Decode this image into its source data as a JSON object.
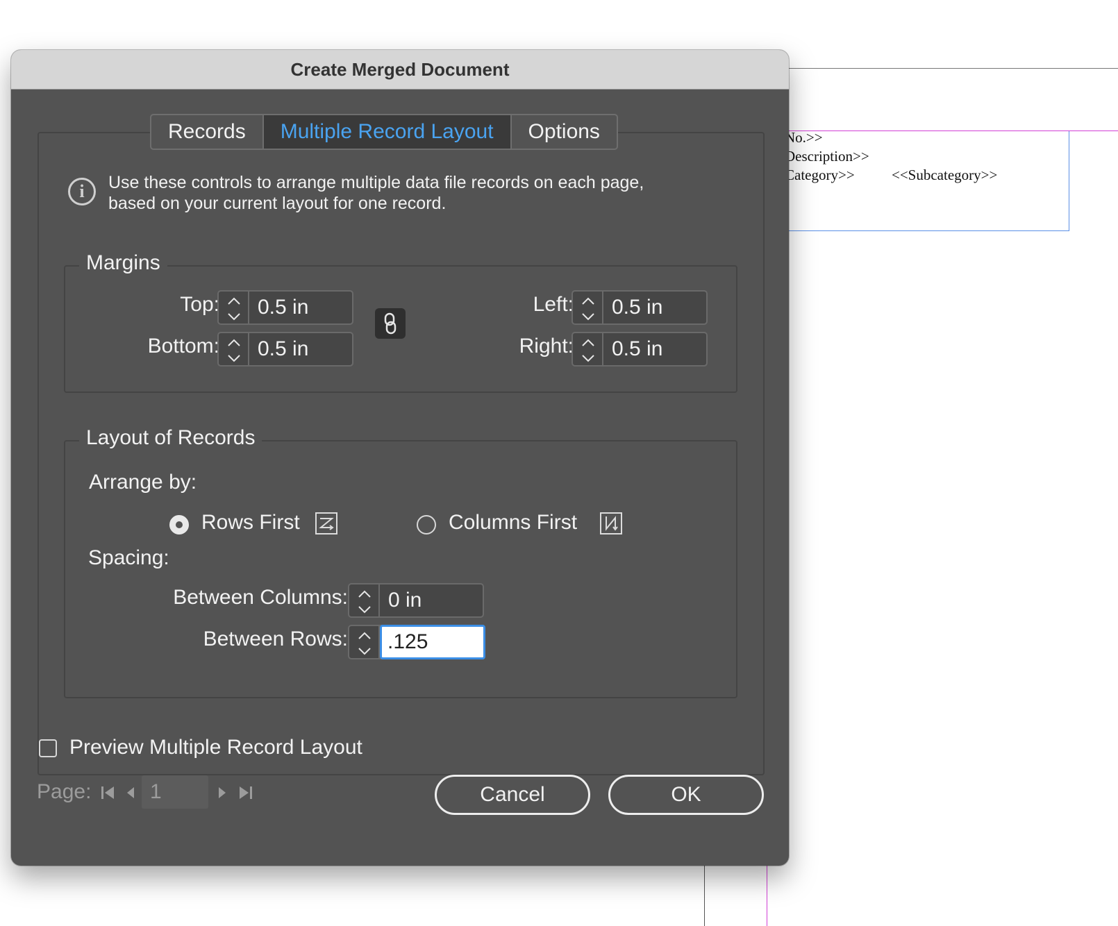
{
  "document": {
    "lines": [
      "No.>>",
      "Description>>",
      "Category>>",
      "<<Subcategory>>"
    ]
  },
  "dialog": {
    "title": "Create Merged Document",
    "tabs": [
      {
        "label": "Records",
        "active": false
      },
      {
        "label": "Multiple Record Layout",
        "active": true
      },
      {
        "label": "Options",
        "active": false
      }
    ],
    "info_line1": "Use these controls to arrange multiple data file records on each page,",
    "info_line2": "based on your current layout for one record.",
    "margins": {
      "legend": "Margins",
      "top_label": "Top:",
      "top_value": "0.5 in",
      "bottom_label": "Bottom:",
      "bottom_value": "0.5 in",
      "left_label": "Left:",
      "left_value": "0.5 in",
      "right_label": "Right:",
      "right_value": "0.5 in"
    },
    "layout": {
      "legend": "Layout of Records",
      "arrange_label": "Arrange by:",
      "rows_first": "Rows First",
      "columns_first": "Columns First",
      "selected": "Rows First",
      "spacing_label": "Spacing:",
      "between_columns_label": "Between Columns:",
      "between_columns_value": "0 in",
      "between_rows_label": "Between Rows:",
      "between_rows_value": ".125"
    },
    "preview_label": "Preview Multiple Record Layout",
    "preview_checked": false,
    "page_label": "Page:",
    "page_value": "1",
    "cancel": "Cancel",
    "ok": "OK"
  },
  "colors": {
    "dialog_bg": "#535353",
    "active_tab_text": "#4aa3f0",
    "focus_ring": "#3b8ee6"
  }
}
